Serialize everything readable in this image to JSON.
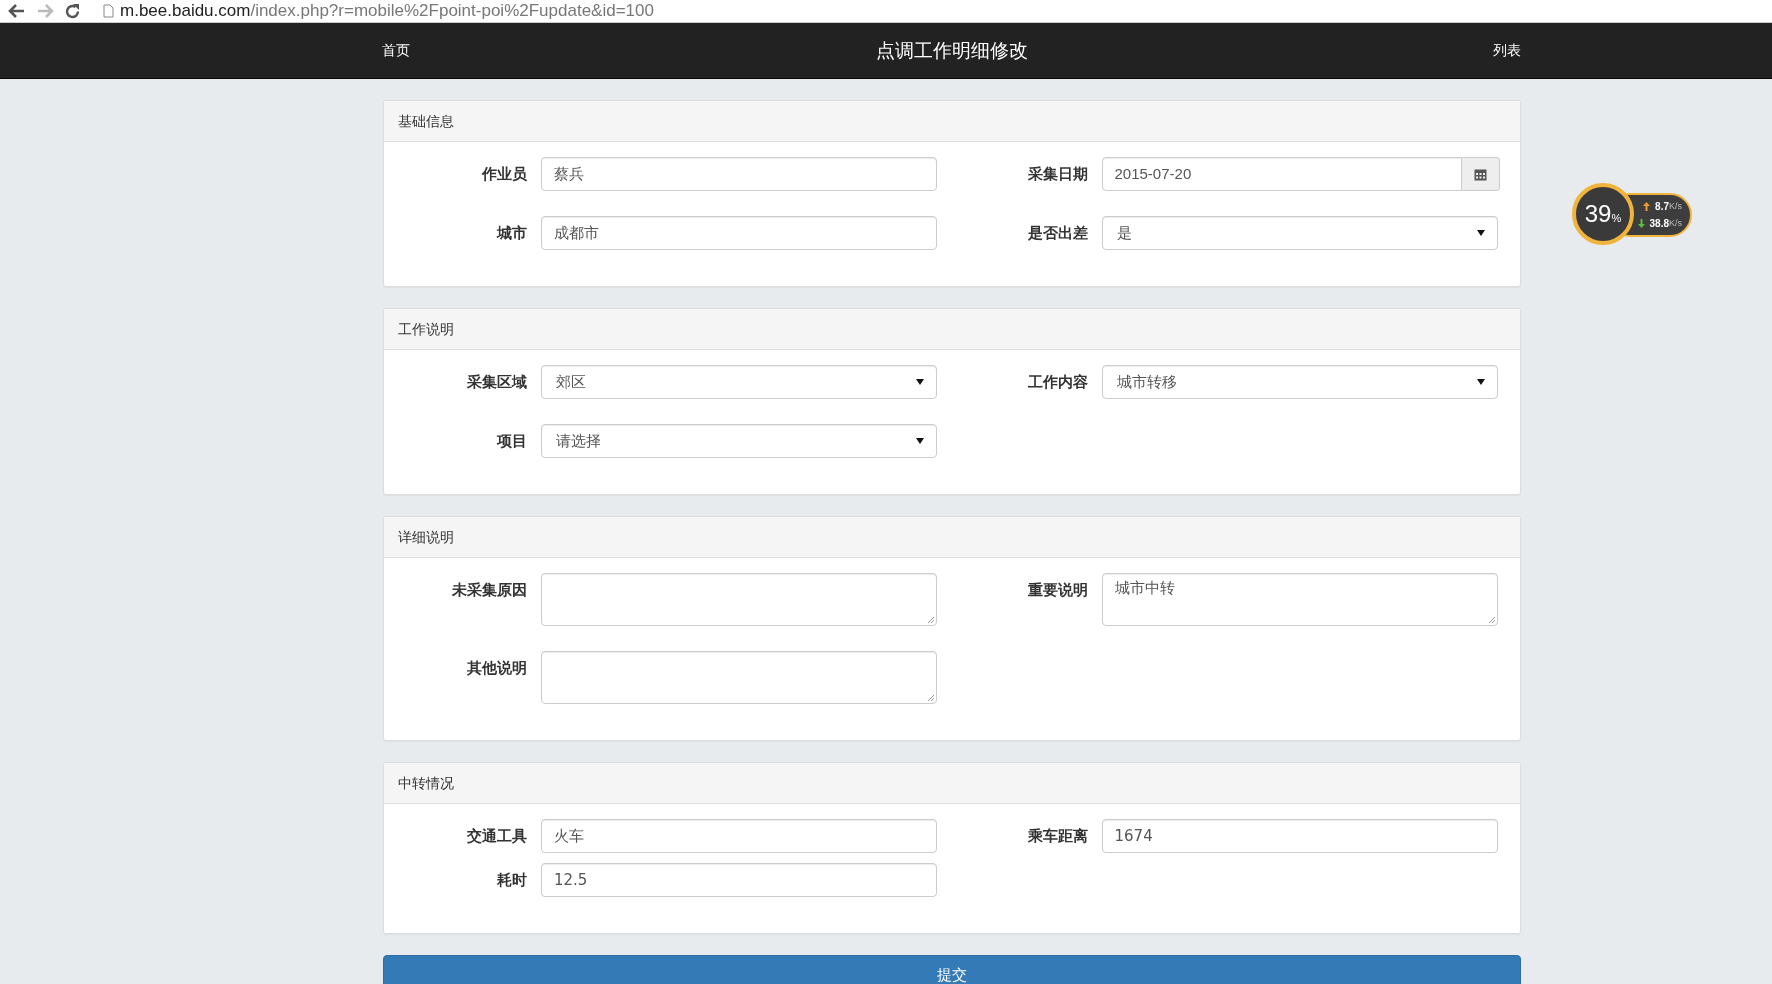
{
  "browser": {
    "nav_buttons": [
      {
        "kind": "back",
        "disabled": false
      },
      {
        "kind": "forward",
        "disabled": true
      },
      {
        "kind": "reload",
        "disabled": false
      }
    ],
    "url_host": "m.bee.baidu.com",
    "url_path": "/index.php?r=mobile%2Fpoint-poi%2Fupdate&id=100"
  },
  "navbar": {
    "left_link": "首页",
    "title": "点调工作明细修改",
    "right_link": "列表"
  },
  "panels": [
    {
      "title": "基础信息",
      "fields": [
        {
          "label": "作业员",
          "kind": "text",
          "value": "蔡兵"
        },
        {
          "label": "采集日期",
          "kind": "date",
          "value": "2015-07-20"
        },
        {
          "label": "城市",
          "kind": "text",
          "value": "成都市"
        },
        {
          "label": "是否出差",
          "kind": "select",
          "value": "是"
        }
      ]
    },
    {
      "title": "工作说明",
      "fields": [
        {
          "label": "采集区域",
          "kind": "select",
          "value": "郊区"
        },
        {
          "label": "工作内容",
          "kind": "select",
          "value": "城市转移"
        },
        {
          "label": "项目",
          "kind": "select",
          "value": "请选择"
        }
      ]
    },
    {
      "title": "详细说明",
      "fields": [
        {
          "label": "未采集原因",
          "kind": "textarea"
        },
        {
          "label": "重要说明",
          "kind": "textarea",
          "value": "城市中转"
        },
        {
          "label": "其他说明",
          "kind": "textarea"
        }
      ]
    },
    {
      "title": "中转情况",
      "fields": [
        {
          "label": "交通工具",
          "kind": "text",
          "value": "火车"
        },
        {
          "label": "乘车距离",
          "kind": "text",
          "value": "1674"
        },
        {
          "label": "耗时",
          "kind": "text",
          "value": "12.5"
        }
      ]
    }
  ],
  "submit_button": "提交",
  "speed_widget": {
    "percent": "39",
    "percent_unit": "%",
    "upload": "8.7",
    "upload_unit": "K/s",
    "download": "38.8",
    "download_unit": "K/s"
  }
}
